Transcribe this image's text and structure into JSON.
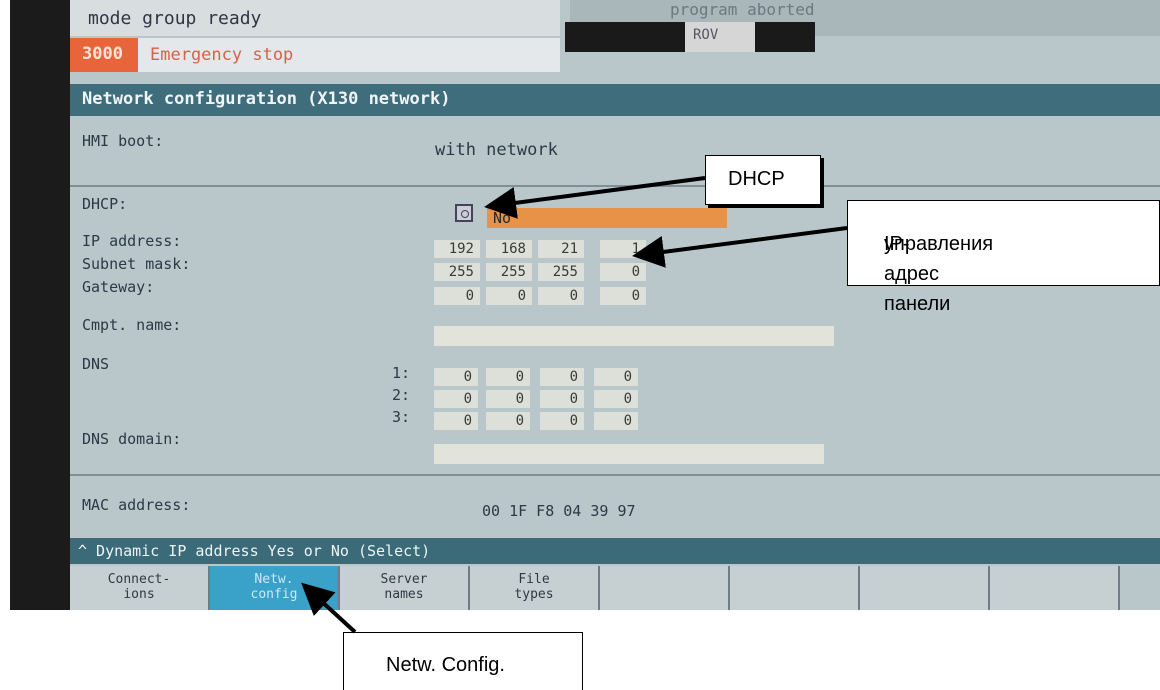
{
  "status": {
    "mode_group": "mode group ready",
    "top_right_partial": "program aborted",
    "rov": "ROV",
    "alarm_number": "3000",
    "alarm_text": "Emergency stop"
  },
  "title": "Network configuration (X130 network)",
  "hmi_boot": {
    "label": "HMI boot:",
    "value": "with network"
  },
  "dhcp": {
    "label": "DHCP:",
    "value": "No"
  },
  "ip_address": {
    "label": "IP address:",
    "octets": [
      "192",
      "168",
      "21",
      "1"
    ]
  },
  "subnet_mask": {
    "label": "Subnet mask:",
    "octets": [
      "255",
      "255",
      "255",
      "0"
    ]
  },
  "gateway": {
    "label": "Gateway:",
    "octets": [
      "0",
      "0",
      "0",
      "0"
    ]
  },
  "computer_name": {
    "label": "Cmpt. name:",
    "value": ""
  },
  "dns": {
    "label": "DNS",
    "servers": [
      {
        "index": "1:",
        "octets": [
          "0",
          "0",
          "0",
          "0"
        ]
      },
      {
        "index": "2:",
        "octets": [
          "0",
          "0",
          "0",
          "0"
        ]
      },
      {
        "index": "3:",
        "octets": [
          "0",
          "0",
          "0",
          "0"
        ]
      }
    ]
  },
  "dns_domain": {
    "label": "DNS domain:",
    "value": ""
  },
  "mac": {
    "label": "MAC address:",
    "value": "00 1F F8 04 39 97"
  },
  "hint": "^ Dynamic IP address Yes or No (Select)",
  "softkeys": [
    {
      "line1": "Connect-",
      "line2": "ions"
    },
    {
      "line1": "Netw.",
      "line2": "config"
    },
    {
      "line1": "Server",
      "line2": "names"
    },
    {
      "line1": "File",
      "line2": "types"
    },
    {
      "line1": "",
      "line2": ""
    },
    {
      "line1": "",
      "line2": ""
    },
    {
      "line1": "",
      "line2": ""
    },
    {
      "line1": "",
      "line2": ""
    }
  ],
  "annotations": {
    "dhcp": "DHCP",
    "ip_line1": "IP-адрес панели",
    "ip_line2": "управления",
    "netw": "Netw. Config."
  },
  "colors": {
    "accent_bar": "#3f6d7b",
    "alarm": "#e8653c",
    "dhcp_field": "#e89248",
    "softkey_active": "#3aa1c8"
  }
}
